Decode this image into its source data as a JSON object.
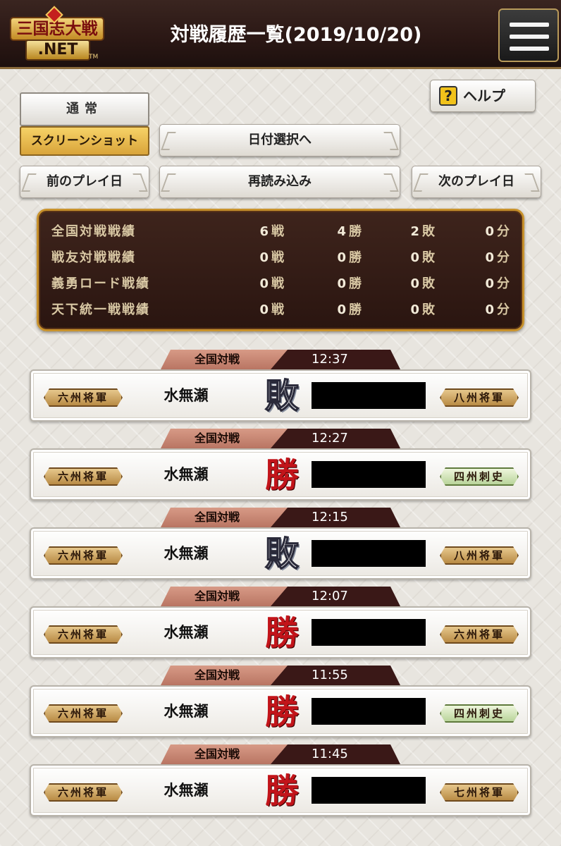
{
  "header": {
    "logo_main": "三国志大戦",
    "logo_sub": ".NET",
    "logo_tm": "TM",
    "title": "対戦履歴一覧(2019/10/20)"
  },
  "mode": {
    "normal_label": "通常",
    "screenshot_label": "スクリーンショット"
  },
  "help_label": "ヘルプ",
  "help_icon_glyph": "?",
  "nav": {
    "date_select": "日付選択へ",
    "prev_day": "前のプレイ日",
    "reload": "再読み込み",
    "next_day": "次のプレイ日"
  },
  "stats": [
    {
      "label": "全国対戦戦績",
      "battles": "6",
      "wins": "4",
      "losses": "2",
      "draws": "0"
    },
    {
      "label": "戦友対戦戦績",
      "battles": "0",
      "wins": "0",
      "losses": "0",
      "draws": "0"
    },
    {
      "label": "義勇ロード戦績",
      "battles": "0",
      "wins": "0",
      "losses": "0",
      "draws": "0"
    },
    {
      "label": "天下統一戦戦績",
      "battles": "0",
      "wins": "0",
      "losses": "0",
      "draws": "0"
    }
  ],
  "units": {
    "battles": "戦",
    "wins": "勝",
    "losses": "敗",
    "draws": "分"
  },
  "battles": [
    {
      "mode": "全国対戦",
      "time": "12:37",
      "player_rank": "六州将軍",
      "player_name": "水無瀬",
      "result": "敗",
      "result_type": "lose",
      "opponent_rank": "八州将軍",
      "opponent_rank_style": "gold"
    },
    {
      "mode": "全国対戦",
      "time": "12:27",
      "player_rank": "六州将軍",
      "player_name": "水無瀬",
      "result": "勝",
      "result_type": "win",
      "opponent_rank": "四州刺史",
      "opponent_rank_style": "green"
    },
    {
      "mode": "全国対戦",
      "time": "12:15",
      "player_rank": "六州将軍",
      "player_name": "水無瀬",
      "result": "敗",
      "result_type": "lose",
      "opponent_rank": "八州将軍",
      "opponent_rank_style": "gold"
    },
    {
      "mode": "全国対戦",
      "time": "12:07",
      "player_rank": "六州将軍",
      "player_name": "水無瀬",
      "result": "勝",
      "result_type": "win",
      "opponent_rank": "六州将軍",
      "opponent_rank_style": "gold"
    },
    {
      "mode": "全国対戦",
      "time": "11:55",
      "player_rank": "六州将軍",
      "player_name": "水無瀬",
      "result": "勝",
      "result_type": "win",
      "opponent_rank": "四州刺史",
      "opponent_rank_style": "green"
    },
    {
      "mode": "全国対戦",
      "time": "11:45",
      "player_rank": "六州将軍",
      "player_name": "水無瀬",
      "result": "勝",
      "result_type": "win",
      "opponent_rank": "七州将軍",
      "opponent_rank_style": "gold"
    }
  ]
}
